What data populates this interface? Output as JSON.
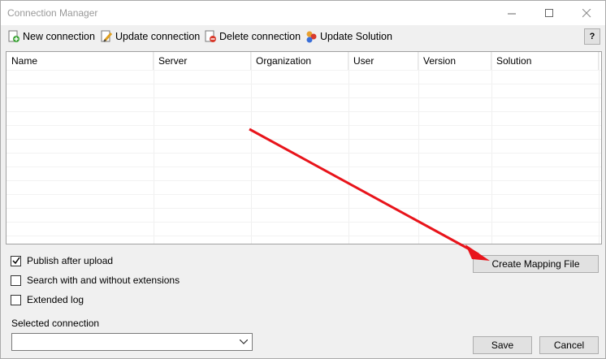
{
  "window": {
    "title": "Connection Manager"
  },
  "toolbar": {
    "new_label": "New connection",
    "update_label": "Update connection",
    "delete_label": "Delete connection",
    "solution_label": "Update Solution",
    "help_label": "?"
  },
  "table": {
    "columns": [
      "Name",
      "Server",
      "Organization",
      "User",
      "Version",
      "Solution"
    ],
    "rows": []
  },
  "options": {
    "publish_label": "Publish after upload",
    "publish_checked": true,
    "search_label": "Search with and without extensions",
    "search_checked": false,
    "extended_label": "Extended log",
    "extended_checked": false
  },
  "mapping_button_label": "Create Mapping File",
  "selected_connection": {
    "label": "Selected connection",
    "value": ""
  },
  "buttons": {
    "save_label": "Save",
    "cancel_label": "Cancel"
  },
  "colors": {
    "annotation_arrow": "#e8141b"
  }
}
